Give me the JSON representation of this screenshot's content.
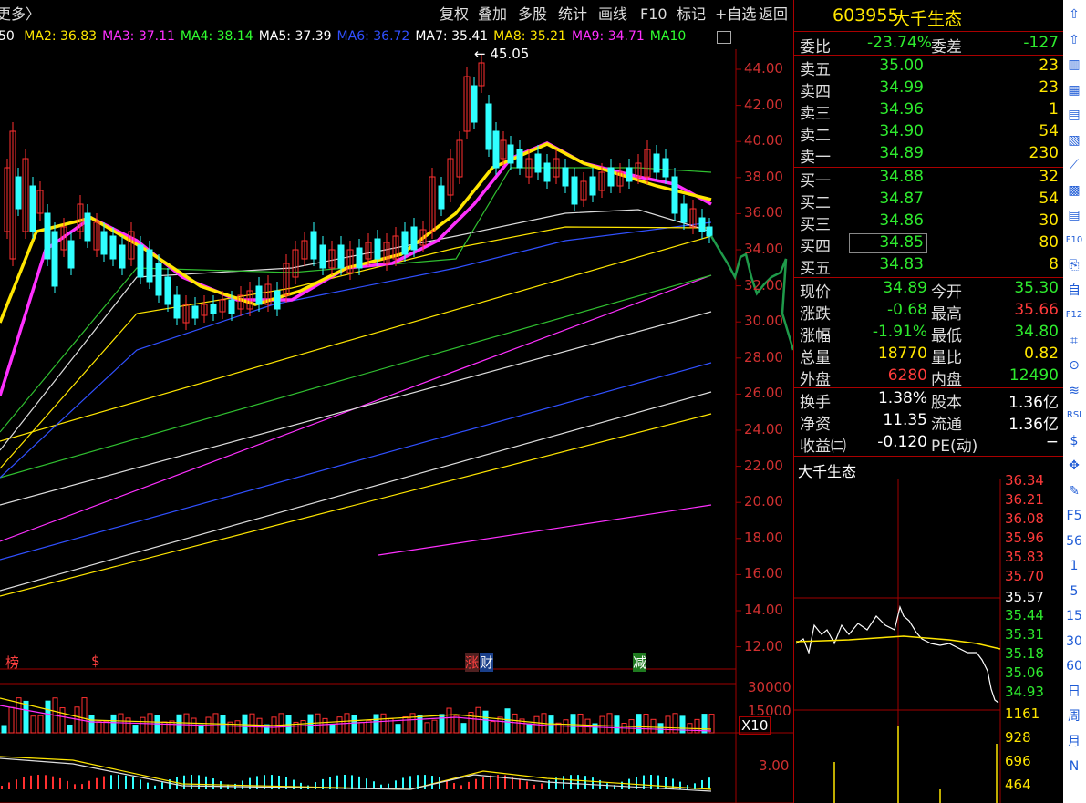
{
  "topbar": {
    "more_label": "更多〉",
    "left_num": "50",
    "buttons": [
      "复权",
      "叠加",
      "多股",
      "统计",
      "画线",
      "F10",
      "标记",
      "+自选",
      "返回"
    ]
  },
  "ma_legend": [
    {
      "label": "MA2: 36.83",
      "color": "#ffe600"
    },
    {
      "label": "MA3: 37.11",
      "color": "#ff30ff"
    },
    {
      "label": "MA4: 38.14",
      "color": "#30ff30"
    },
    {
      "label": "MA5: 37.39",
      "color": "#ffffff"
    },
    {
      "label": "MA6: 36.72",
      "color": "#3050ff"
    },
    {
      "label": "MA7: 35.41",
      "color": "#ffffff"
    },
    {
      "label": "MA8: 35.21",
      "color": "#ffe600"
    },
    {
      "label": "MA9: 34.71",
      "color": "#ff30ff"
    },
    {
      "label": "MA10",
      "color": "#30ff30"
    }
  ],
  "price_axis": [
    "44.00",
    "42.00",
    "40.00",
    "38.00",
    "36.00",
    "34.00",
    "32.00",
    "30.00",
    "28.00",
    "26.00",
    "24.00",
    "22.00",
    "20.00",
    "18.00",
    "16.00",
    "14.00",
    "12.00"
  ],
  "high_marker": "45.05",
  "event_tags": [
    {
      "text": "榜",
      "color": "#ff4040"
    },
    {
      "text": "$",
      "color": "#ff4040"
    },
    {
      "text": "涨",
      "color": "#ff4040"
    },
    {
      "text": "财",
      "color": "#3080ff"
    },
    {
      "text": "减",
      "color": "#30ff30"
    }
  ],
  "volume_axis": [
    "30000",
    "15000"
  ],
  "volume_unit": "X10",
  "macd_axis": [
    "3.00"
  ],
  "quote": {
    "code": "603955",
    "name": "大千生态",
    "webi_label": "委比",
    "webi_value": "-23.74%",
    "weicha_label": "委差",
    "weicha_value": "-127",
    "asks": [
      {
        "label": "卖五",
        "price": "35.00",
        "vol": "23"
      },
      {
        "label": "卖四",
        "price": "34.99",
        "vol": "23"
      },
      {
        "label": "卖三",
        "price": "34.96",
        "vol": "1"
      },
      {
        "label": "卖二",
        "price": "34.90",
        "vol": "54"
      },
      {
        "label": "卖一",
        "price": "34.89",
        "vol": "230"
      }
    ],
    "bids": [
      {
        "label": "买一",
        "price": "34.88",
        "vol": "32"
      },
      {
        "label": "买二",
        "price": "34.87",
        "vol": "54"
      },
      {
        "label": "买三",
        "price": "34.86",
        "vol": "30"
      },
      {
        "label": "买四",
        "price": "34.85",
        "vol": "80"
      },
      {
        "label": "买五",
        "price": "34.83",
        "vol": "8"
      }
    ],
    "stats": [
      {
        "l1": "现价",
        "v1": "34.89",
        "c1": "green",
        "l2": "今开",
        "v2": "35.30",
        "c2": "green"
      },
      {
        "l1": "涨跌",
        "v1": "-0.68",
        "c1": "green",
        "l2": "最高",
        "v2": "35.66",
        "c2": "red"
      },
      {
        "l1": "涨幅",
        "v1": "-1.91%",
        "c1": "green",
        "l2": "最低",
        "v2": "34.80",
        "c2": "green"
      },
      {
        "l1": "总量",
        "v1": "18770",
        "c1": "yellow",
        "l2": "量比",
        "v2": "0.82",
        "c2": "yellow"
      },
      {
        "l1": "外盘",
        "v1": "6280",
        "c1": "red",
        "l2": "内盘",
        "v2": "12490",
        "c2": "green"
      }
    ],
    "stats2": [
      {
        "l1": "换手",
        "v1": "1.38%",
        "l2": "股本",
        "v2": "1.36亿"
      },
      {
        "l1": "净资",
        "v1": "11.35",
        "l2": "流通",
        "v2": "1.36亿"
      },
      {
        "l1": "收益㈡",
        "v1": "-0.120",
        "l2": "PE(动)",
        "v2": "−"
      }
    ],
    "mini_title": "大千生态",
    "mini_axis_up": [
      "36.34",
      "36.21",
      "36.08",
      "35.96",
      "35.83",
      "35.70"
    ],
    "mini_axis_mid": "35.57",
    "mini_axis_down": [
      "35.44",
      "35.31",
      "35.18",
      "35.06",
      "34.93"
    ],
    "mini_vol_axis": [
      "1161",
      "928",
      "696",
      "464"
    ]
  },
  "toolbar": {
    "items": [
      "⇧",
      "⇧",
      "▥",
      "▦",
      "▤",
      "▧",
      "⟋",
      "▩",
      "▤",
      "F10",
      "⎘",
      "自",
      "F12",
      "⌗",
      "⊙",
      "≋",
      "RSI",
      "$",
      "✥",
      "✎",
      "F5",
      "56",
      "1",
      "5",
      "15",
      "30",
      "60",
      "日",
      "周",
      "月",
      "N"
    ]
  },
  "colors": {
    "up": "#ff3030",
    "down": "#30ffff",
    "axis": "#a00000"
  }
}
